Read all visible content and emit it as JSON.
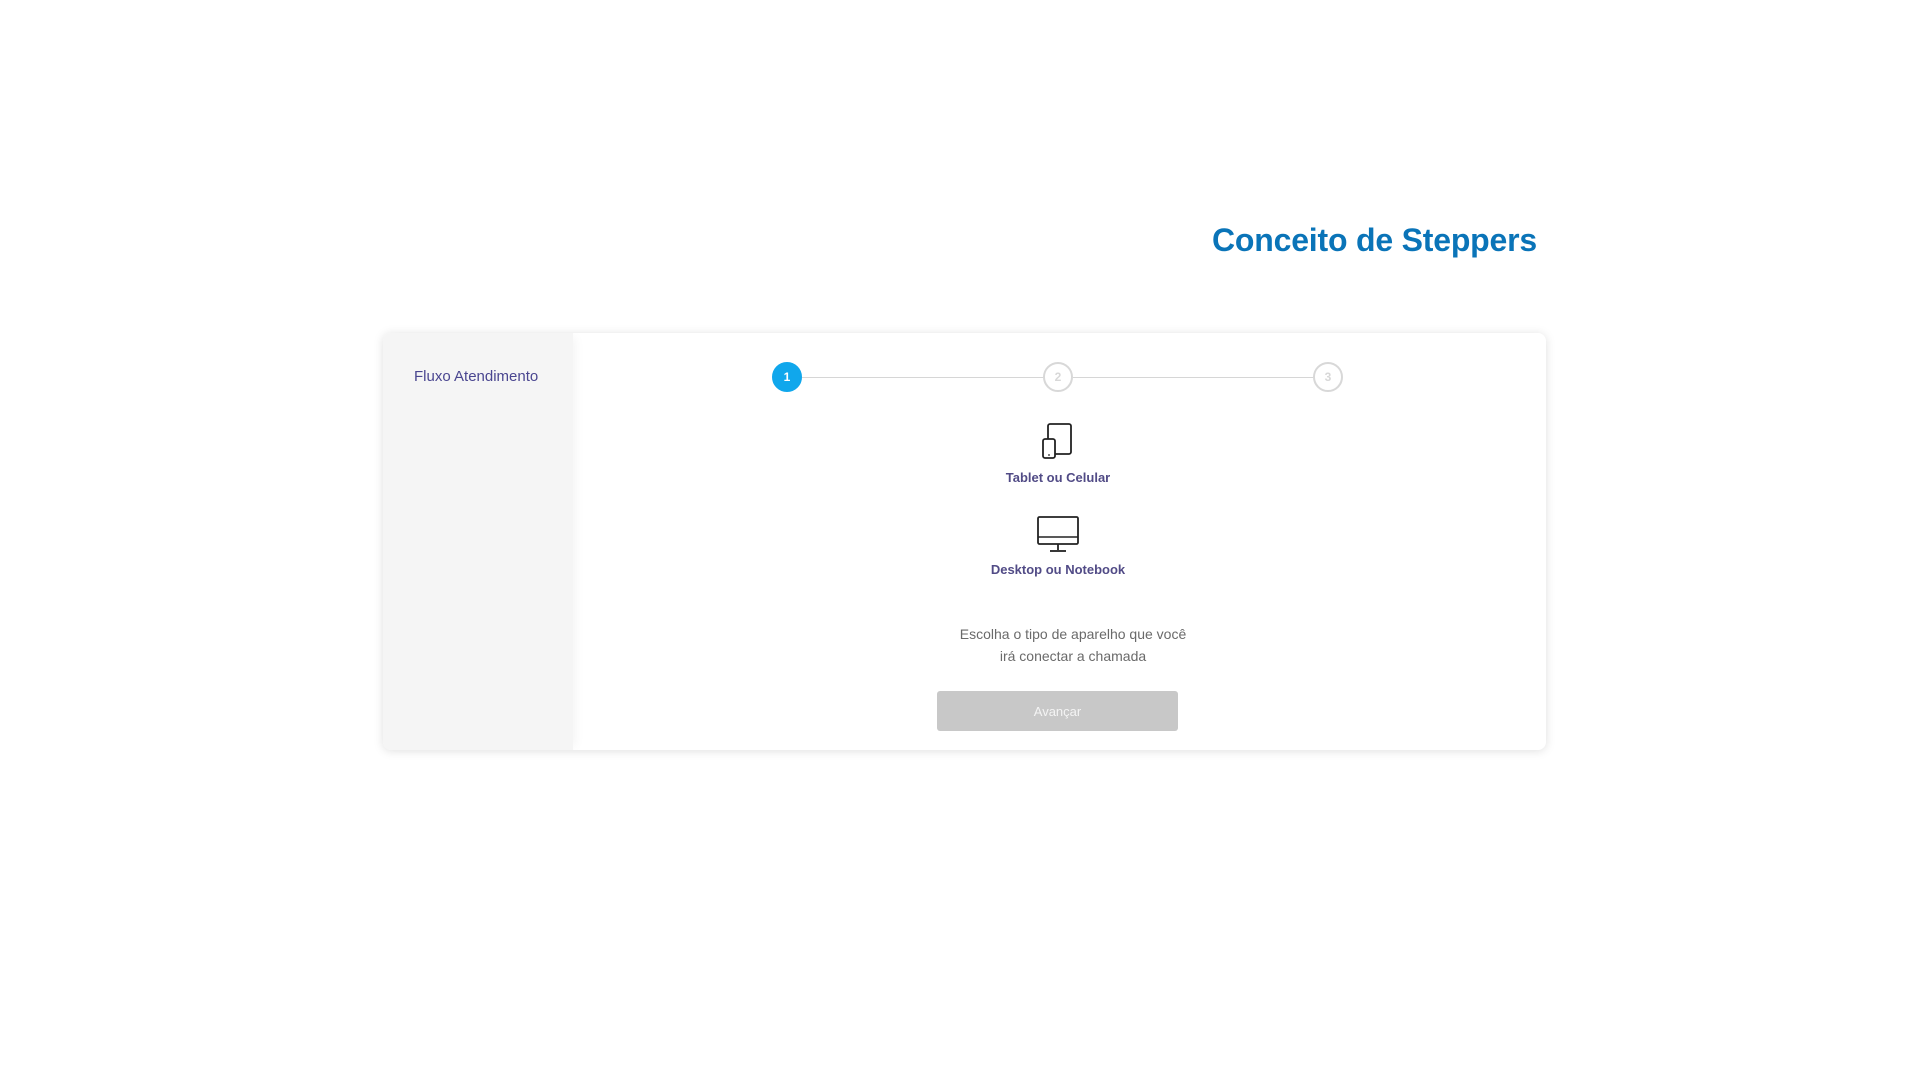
{
  "page": {
    "title": "Conceito de Steppers"
  },
  "sidebar": {
    "title": "Fluxo Atendimento"
  },
  "stepper": {
    "steps": [
      {
        "number": "1",
        "state": "active"
      },
      {
        "number": "2",
        "state": "inactive"
      },
      {
        "number": "3",
        "state": "inactive"
      }
    ],
    "current_step": 1
  },
  "devices": {
    "options": [
      {
        "label": "Tablet ou Celular",
        "icon": "tablet-phone-icon"
      },
      {
        "label": "Desktop ou Notebook",
        "icon": "desktop-monitor-icon"
      }
    ]
  },
  "instruction": {
    "line1": "Escolha o tipo de aparelho que você",
    "line2": "irá conectar a chamada"
  },
  "actions": {
    "next_label": "Avançar",
    "next_disabled": true
  },
  "colors": {
    "title": "#0a74b8",
    "accent": "#10a7ec",
    "label": "#514b86",
    "disabled_button": "#c8c8c8"
  }
}
